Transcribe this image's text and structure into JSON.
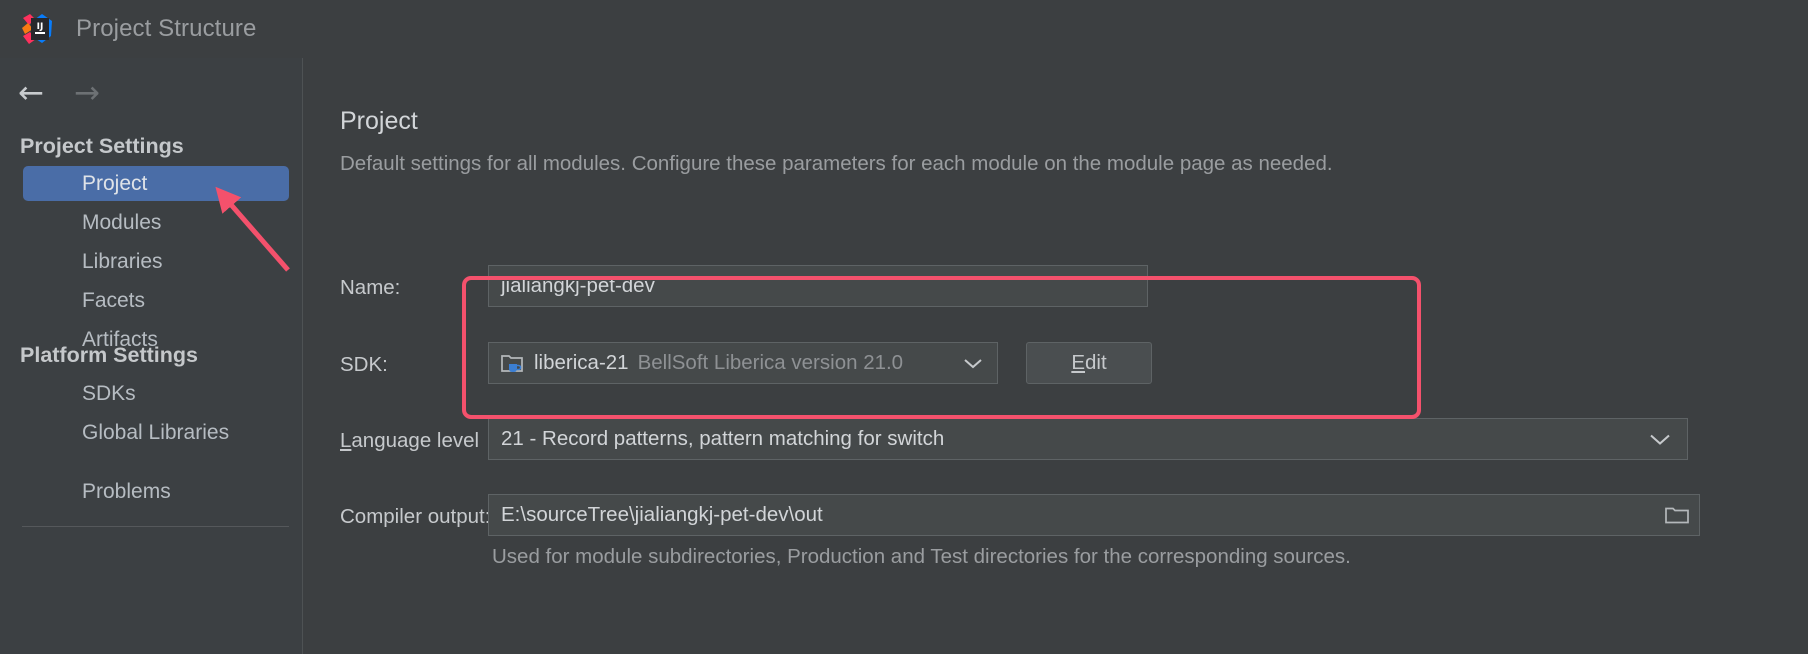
{
  "window": {
    "title": "Project Structure",
    "logo_icon": "intellij-idea-logo"
  },
  "navigation": {
    "back_icon": "arrow-left-icon",
    "forward_icon": "arrow-right-icon"
  },
  "sidebar": {
    "sections": [
      {
        "header": "Project Settings"
      },
      {
        "header": "Platform Settings"
      }
    ],
    "project_settings_items": [
      {
        "label": "Project",
        "selected": true
      },
      {
        "label": "Modules",
        "selected": false
      },
      {
        "label": "Libraries",
        "selected": false
      },
      {
        "label": "Facets",
        "selected": false
      },
      {
        "label": "Artifacts",
        "selected": false
      }
    ],
    "platform_settings_items": [
      {
        "label": "SDKs",
        "selected": false
      },
      {
        "label": "Global Libraries",
        "selected": false
      }
    ],
    "footer_items": [
      {
        "label": "Problems",
        "selected": false
      }
    ]
  },
  "main": {
    "title": "Project",
    "description": "Default settings for all modules. Configure these parameters for each module on the module page as needed.",
    "fields": {
      "name": {
        "label": "Name:",
        "value": "jialiangkj-pet-dev"
      },
      "sdk": {
        "label": "SDK:",
        "value": "liberica-21",
        "value_detail": "BellSoft Liberica version 21.0",
        "icon": "jdk-folder-icon",
        "chevron_icon": "chevron-down-icon",
        "edit_button": "Edit",
        "edit_button_mnemonic": "E"
      },
      "language_level": {
        "label": "Language level",
        "label_mnemonic": "L",
        "value": "21 - Record patterns, pattern matching for switch",
        "chevron_icon": "chevron-down-icon"
      },
      "compiler_output": {
        "label": "Compiler output:",
        "value": "E:\\sourceTree\\jialiangkj-pet-dev\\out",
        "browse_icon": "folder-browse-icon",
        "hint": "Used for module subdirectories, Production and Test directories for the corresponding sources."
      }
    }
  },
  "annotations": {
    "highlight_color": "#f4516c",
    "arrow_icon": "arrow-pointer-annotation",
    "box_icon": "highlight-rectangle-annotation"
  },
  "colors": {
    "window_bg": "#3c3f41",
    "sidebar_bg": "#3c4043",
    "selection_blue": "#4a6da7",
    "field_bg": "#45494a",
    "accent_red": "#f4516c"
  }
}
